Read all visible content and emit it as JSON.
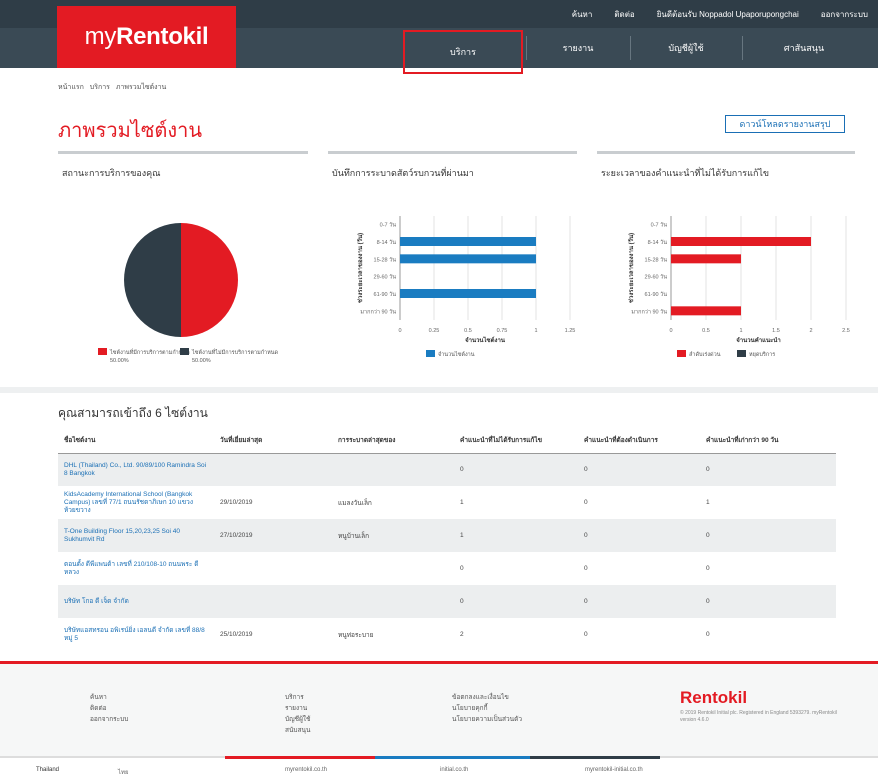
{
  "topbar": {
    "links": [
      "ค้นหา",
      "ติดต่อ",
      "ยินดีต้อนรับ Noppadol Upaporupongchai",
      "ออกจากระบบ"
    ]
  },
  "logo": {
    "prefix": "my",
    "brand": "Rentokil"
  },
  "nav": {
    "items": [
      "บริการ",
      "รายงาน",
      "บัญชีผู้ใช้",
      "ศาสันสนุน"
    ],
    "active_index": 0
  },
  "breadcrumb": [
    "หน้าแรก",
    "บริการ",
    "ภาพรวมไซต์งาน"
  ],
  "page": {
    "title": "ภาพรวมไซต์งาน",
    "download_button": "ดาวน์โหลดรายงานสรุป"
  },
  "panels": {
    "service_status": {
      "title": "สถานะการบริการของคุณ"
    },
    "pest_activity": {
      "title": "บันทึกการระบาดสัตว์รบกวนที่ผ่านมา"
    },
    "unresolved": {
      "title": "ระยะเวลาของคำแนะนำที่ไม่ได้รับการแก้ไข"
    }
  },
  "chart_data": [
    {
      "type": "pie",
      "categories": [
        "ไซต์งานที่มีการบริการตามกำหนด",
        "ไซต์งานที่ไม่มีการบริการตามกำหนด"
      ],
      "values": [
        50,
        50
      ],
      "value_labels": [
        "50.00%",
        "50.00%"
      ],
      "colors": [
        "#e31b23",
        "#2f3d47"
      ],
      "legend": "bottom"
    },
    {
      "type": "bar",
      "orientation": "horizontal",
      "categories": [
        "0-7 วัน",
        "8-14 วัน",
        "15-28 วัน",
        "29-60 วัน",
        "61-90 วัน",
        "มากกว่า 90 วัน"
      ],
      "series": [
        {
          "name": "จำนวนไซต์งาน",
          "values": [
            0,
            1,
            1,
            0,
            1,
            0
          ],
          "color": "#1a7cc1"
        }
      ],
      "ticks": [
        "0",
        "0.25",
        "0.5",
        "0.75",
        "1",
        "1.25"
      ],
      "xlim": [
        0,
        1.25
      ],
      "xlabel": "จำนวนไซต์งาน",
      "ylabel": "ช่วงระยะเวลาของงาน (วัน)",
      "legend": "bottom"
    },
    {
      "type": "bar",
      "orientation": "horizontal",
      "categories": [
        "0-7 วัน",
        "8-14 วัน",
        "15-28 วัน",
        "29-60 วัน",
        "61-90 วัน",
        "มากกว่า 90 วัน"
      ],
      "series": [
        {
          "name": "ลำดับเร่งด่วน",
          "values": [
            0,
            2,
            1,
            0,
            0,
            1
          ],
          "color": "#e31b23"
        },
        {
          "name": "หยุดบริการ",
          "values": [
            0,
            0,
            0,
            0,
            0,
            0
          ],
          "color": "#2f3d47"
        }
      ],
      "ticks": [
        "0",
        "0.5",
        "1",
        "1.5",
        "2",
        "2.5"
      ],
      "xlim": [
        0,
        2.5
      ],
      "xlabel": "จำนวนคำแนะนำ",
      "ylabel": "ช่วงระยะเวลาของงาน (วัน)",
      "legend": "bottom"
    }
  ],
  "sites": {
    "heading": "คุณสามารถเข้าถึง 6 ไซต์งาน",
    "columns": [
      "ชื่อไซต์งาน",
      "วันที่เยี่ยมล่าสุด",
      "การระบาดล่าสุดของ",
      "คำแนะนำที่ไม่ได้รับการแก้ไข",
      "คำแนะนำที่ต้องดำเนินการ",
      "คำแนะนำที่เก่ากว่า 90 วัน"
    ],
    "rows": [
      {
        "name": "DHL (Thailand) Co., Ltd. 90/89/100 Ramindra Soi 8 Bangkok",
        "date": "",
        "pest": "",
        "c1": "0",
        "c2": "0",
        "c3": "0"
      },
      {
        "name": "KidsAcademy International School (Bangkok Campus) เลขที่ 77/1 ถนนรัชดาภิเษก 10 แขวง ห้วยขวาง",
        "date": "29/10/2019",
        "pest": "แมลงวันเล็ก",
        "c1": "1",
        "c2": "0",
        "c3": "1"
      },
      {
        "name": "T-One Building Floor 15,20,23,25 Soi 40 Sukhumvit Rd",
        "date": "27/10/2019",
        "pest": "หนูบ้านเล็ก",
        "c1": "1",
        "c2": "0",
        "c3": "0"
      },
      {
        "name": "ตอนตั้ง ดีพีแพนด้า เลขที่ 210/108-10 ถนนพระ ดีหลวง",
        "date": "",
        "pest": "",
        "c1": "0",
        "c2": "0",
        "c3": "0"
      },
      {
        "name": "บริษัท โกอ ดี เจ็ด จำกัด",
        "date": "",
        "pest": "",
        "c1": "0",
        "c2": "0",
        "c3": "0"
      },
      {
        "name": "บริษัทแอสทรอน อพิเรน์ยิ่ง เอลนดี จำกัด เลขที่ 88/8 หมู่ 5",
        "date": "25/10/2019",
        "pest": "หนูท่อระบาย",
        "c1": "2",
        "c2": "0",
        "c3": "0"
      }
    ]
  },
  "footer": {
    "col1": [
      "ค้นหา",
      "ติดต่อ",
      "ออกจากระบบ"
    ],
    "col2": [
      "บริการ",
      "รายงาน",
      "บัญชีผู้ใช้",
      "สนับสนุน"
    ],
    "col3": [
      "ข้อตกลงและเงื่อนไข",
      "นโยบายคุกกี้",
      "นโยบายความเป็นส่วนตัว"
    ],
    "brand": "Rentokil",
    "copyright": "© 2019 Rentokil Initial plc. Registered in England 5393279. myRentokil version 4.6.0"
  },
  "bottom": {
    "country": "Thailand",
    "lang": "ไทย",
    "items": [
      "myrentokil.co.th",
      "initial.co.th",
      "myrentokil-initial.co.th"
    ]
  }
}
